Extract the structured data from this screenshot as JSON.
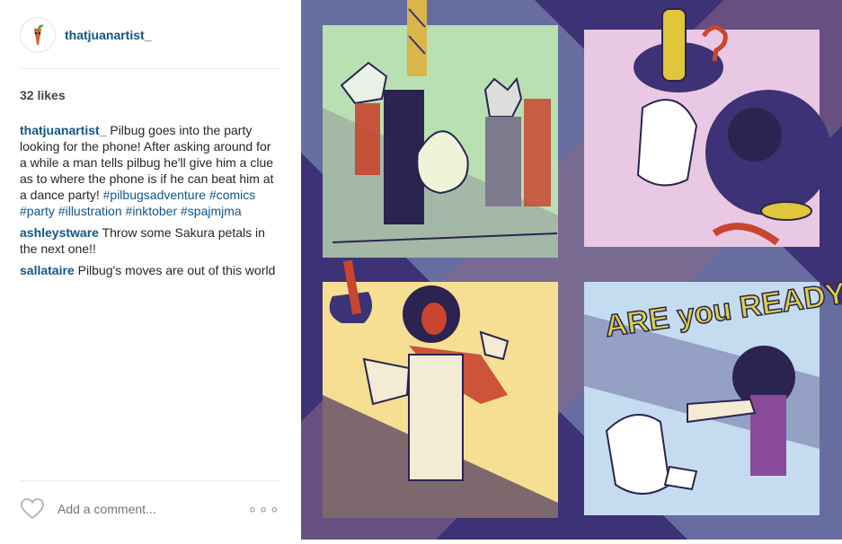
{
  "post": {
    "username": "thatjuanartist_",
    "likes": "32 likes",
    "caption_user": "thatjuanartist_",
    "caption_text": " Pilbug goes into the party looking for the phone! After asking around for a while a man tells pilbug he'll give him a clue as to where the phone is if he can beat him at a dance party! ",
    "hashtags": [
      "#pilbugsadventure",
      "#comics",
      "#party",
      "#illustration",
      "#inktober",
      "#spajmjma"
    ],
    "comments": [
      {
        "user": "ashleystware",
        "text": " Throw some Sakura petals in the next one!!"
      },
      {
        "user": "sallataire",
        "text": " Pilbug's moves are out of this world"
      }
    ]
  },
  "footer": {
    "comment_placeholder": "Add a comment...",
    "more_label": "∘∘∘"
  },
  "comic": {
    "text": "ARE you READY?",
    "colors": {
      "background": "#3d3275",
      "diagonal_band": "#6f78a6",
      "panel_green": "#b9e0b2",
      "panel_pink": "#e9c8e3",
      "panel_yellow": "#f6df92",
      "panel_blue": "#c5dcf0",
      "accent_red": "#c9452f",
      "accent_gold": "#e0c63a"
    }
  }
}
